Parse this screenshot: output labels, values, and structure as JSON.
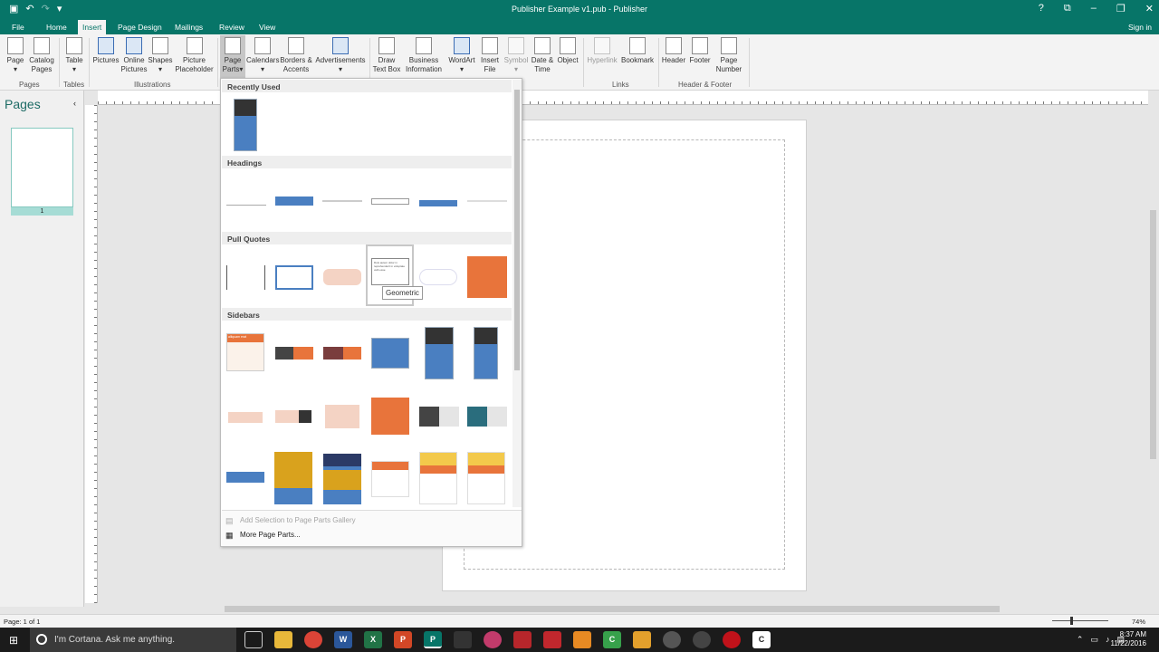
{
  "title_bar": {
    "title": "Publisher Example v1.pub - Publisher",
    "qat_icons": [
      "save-icon",
      "undo-icon",
      "redo-icon",
      "customize-icon"
    ]
  },
  "menu": {
    "tabs": [
      "File",
      "Home",
      "Insert",
      "Page Design",
      "Mailings",
      "Review",
      "View"
    ],
    "active_tab": "Insert",
    "sign_in": "Sign in"
  },
  "ribbon": {
    "buttons": [
      {
        "label": "Page",
        "id": "page"
      },
      {
        "label": "Catalog Pages",
        "id": "catalog-pages"
      },
      {
        "label": "Table",
        "id": "table"
      },
      {
        "label": "Pictures",
        "id": "pictures"
      },
      {
        "label": "Online Pictures",
        "id": "online-pictures"
      },
      {
        "label": "Shapes",
        "id": "shapes"
      },
      {
        "label": "Picture Placeholder",
        "id": "picture-placeholder"
      },
      {
        "label": "Page Parts",
        "id": "page-parts"
      },
      {
        "label": "Calendars",
        "id": "calendars"
      },
      {
        "label": "Borders & Accents",
        "id": "borders-accents"
      },
      {
        "label": "Advertisements",
        "id": "advertisements"
      },
      {
        "label": "Draw Text Box",
        "id": "draw-text-box"
      },
      {
        "label": "Business Information",
        "id": "business-information"
      },
      {
        "label": "WordArt",
        "id": "wordart"
      },
      {
        "label": "Insert File",
        "id": "insert-file"
      },
      {
        "label": "Symbol",
        "id": "symbol"
      },
      {
        "label": "Date & Time",
        "id": "date-time"
      },
      {
        "label": "Object",
        "id": "object"
      },
      {
        "label": "Hyperlink",
        "id": "hyperlink"
      },
      {
        "label": "Bookmark",
        "id": "bookmark"
      },
      {
        "label": "Header",
        "id": "header"
      },
      {
        "label": "Footer",
        "id": "footer"
      },
      {
        "label": "Page Number",
        "id": "page-number"
      }
    ],
    "groups": [
      "Pages",
      "Tables",
      "Illustrations",
      "Links",
      "Header & Footer"
    ]
  },
  "pages_panel": {
    "title": "Pages",
    "page_number": "1"
  },
  "page_parts_gallery": {
    "sections": [
      "Recently Used",
      "Headings",
      "Pull Quotes",
      "Sidebars"
    ],
    "tooltip": "Geometric",
    "footer_items": [
      "Add Selection to Page Parts Gallery",
      "More Page Parts..."
    ],
    "thumb_caption": "alliquam erat",
    "thumb_body": "Duis autem dolor in reprehenderit in voluptate velit esse"
  },
  "status_bar": {
    "page_info": "Page: 1 of 1",
    "zoom": "74%",
    "zoom_level": 0.74
  },
  "taskbar": {
    "cortana_placeholder": "I'm Cortana. Ask me anything.",
    "time": "8:37 AM",
    "date": "11/22/2016"
  },
  "colors": {
    "accent": "#077568",
    "orange": "#e8743b",
    "blue": "#4a7fc1"
  }
}
